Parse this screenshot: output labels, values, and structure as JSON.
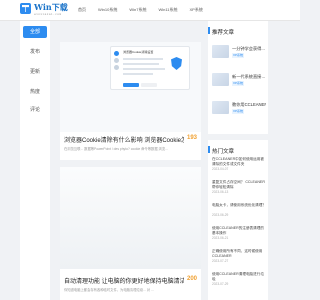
{
  "brand": {
    "name": "Win下载",
    "sub": "winxiazai.com",
    "colors": {
      "accent": "#2d8cf0",
      "count": "#f0a030"
    }
  },
  "nav": [
    "首页",
    "Win10系统",
    "Win7系统",
    "Win11系统",
    "XP系统"
  ],
  "sidebar": [
    "全部",
    "发布",
    "更新",
    "热度",
    "评论"
  ],
  "articles": [
    {
      "title": "浏览器Cookie清除有什么影响 浏览器Cookie怎么...",
      "count": "193",
      "desc": "在浏览互联... 数据等PowerPoint / des phyto? cookie 命令等数据 浏览...",
      "mock": {
        "title": "浏览器Cookie清除设置",
        "icon": "shield-icon"
      }
    },
    {
      "title": "自动清理功能 让电脑的你更好地保持电脑清洁",
      "count": "200",
      "desc": "你知道电脑上都会存有各种临时文件，为电脑清理垃圾... 对 ..."
    }
  ],
  "recommend": {
    "heading": "推荐文章",
    "items": [
      {
        "title": "一分钟学会获得...",
        "tag": "XP系统"
      },
      {
        "title": "新一代系统直接…",
        "tag": "XP系统"
      },
      {
        "title": "教你用CCLEANER…",
        "tag": "XP系统"
      }
    ]
  },
  "hot": {
    "heading": "热门文章",
    "items": [
      {
        "title": "在CCLEANER中如何使用运用被清除的文件或文件夹",
        "date": "2023-04-07"
      },
      {
        "title": "重复文件占存空间？ CCLEANER帮你轻松清除",
        "date": "2023-06-13"
      },
      {
        "title": "电脑太卡，请使用系统优化清理？",
        "date": "2023-06-29"
      },
      {
        "title": "使用CCLEANER的注册表清理的基本操作",
        "date": "2023-06-21"
      },
      {
        "title": "正确使用所有不同，这时候使用CCLEANER",
        "date": "2023-07-27"
      },
      {
        "title": "使用CCLEANER清理电脑进行垃圾",
        "date": "2023-07-29"
      }
    ]
  }
}
